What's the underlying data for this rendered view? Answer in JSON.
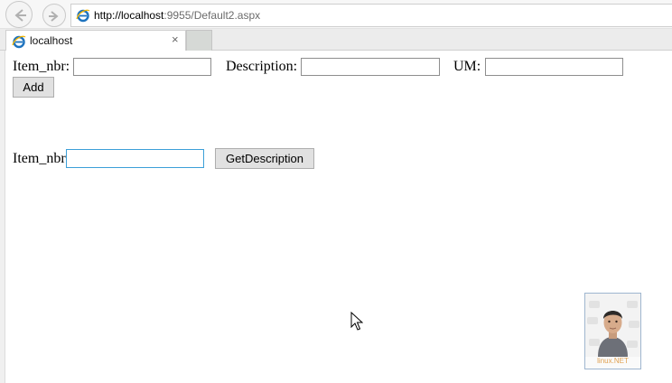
{
  "browser": {
    "url_host": "http://localhost",
    "url_rest": ":9955/Default2.aspx",
    "tab_title": "localhost",
    "tab_close": "×"
  },
  "form1": {
    "item_nbr_label": "Item_nbr:",
    "item_nbr_value": "",
    "description_label": "Description:",
    "description_value": "",
    "um_label": "UM:",
    "um_value": "",
    "add_button": "Add"
  },
  "form2": {
    "item_nbr_label": "Item_nbr",
    "item_nbr_value": "",
    "get_description_button": "GetDescription"
  },
  "watermark": {
    "text": "linux.NET"
  },
  "colors": {
    "ie_blue": "#1e73be",
    "focus_border": "#3c9fd8",
    "button_bg": "#e1e1e1"
  }
}
